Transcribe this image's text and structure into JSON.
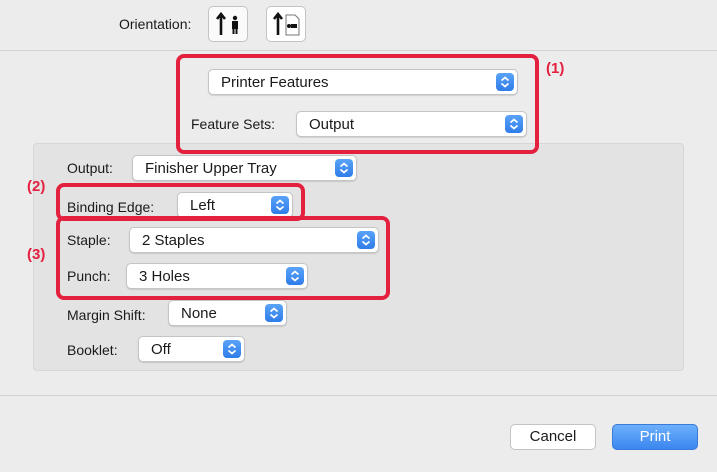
{
  "orientation": {
    "label": "Orientation:"
  },
  "presets": {
    "value": "Printer Features"
  },
  "feature_sets": {
    "label": "Feature Sets:",
    "value": "Output"
  },
  "output": {
    "label": "Output:",
    "value": "Finisher Upper Tray"
  },
  "binding_edge": {
    "label": "Binding Edge:",
    "value": "Left"
  },
  "staple": {
    "label": "Staple:",
    "value": "2 Staples"
  },
  "punch": {
    "label": "Punch:",
    "value": "3 Holes"
  },
  "margin_shift": {
    "label": "Margin Shift:",
    "value": "None"
  },
  "booklet": {
    "label": "Booklet:",
    "value": "Off"
  },
  "callouts": {
    "c1": "(1)",
    "c2": "(2)",
    "c3": "(3)"
  },
  "buttons": {
    "cancel": "Cancel",
    "print": "Print"
  },
  "colors": {
    "highlight": "#e4203f",
    "accent": "#3b86ef",
    "background": "#ececec"
  }
}
